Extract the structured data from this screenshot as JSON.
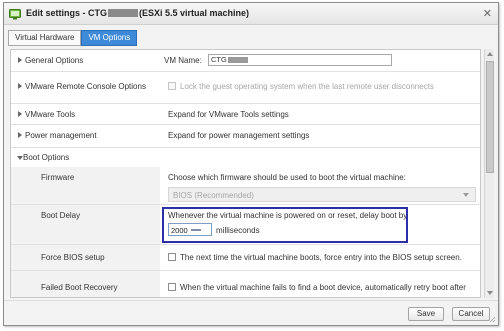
{
  "window": {
    "title_prefix": "Edit settings - CTG",
    "title_suffix": "(ESXi 5.5 virtual machine)",
    "close_symbol": "✕"
  },
  "tabs": [
    {
      "label": "Virtual Hardware",
      "active": false
    },
    {
      "label": "VM Options",
      "active": true
    }
  ],
  "rows": {
    "general": {
      "label": "General Options",
      "vm_name_label": "VM Name:",
      "vm_name_value": "CTG"
    },
    "vmrc": {
      "label": "VMware Remote Console Options",
      "text": "Lock the guest operating system when the last remote user disconnects"
    },
    "tools": {
      "label": "VMware Tools",
      "text": "Expand for VMware Tools settings"
    },
    "power": {
      "label": "Power management",
      "text": "Expand for power management settings"
    },
    "boot": {
      "label": "Boot Options"
    },
    "firmware": {
      "label": "Firmware",
      "text": "Choose which firmware should be used to boot the virtual machine:",
      "select_value": "BIOS (Recommended)"
    },
    "boot_delay": {
      "label": "Boot Delay",
      "text": "Whenever the virtual machine is powered on or reset, delay boot by",
      "value": "2000",
      "unit": "milliseconds"
    },
    "force_bios": {
      "label": "Force BIOS setup",
      "text": "The next time the virtual machine boots, force entry into the BIOS setup screen."
    },
    "failed_boot": {
      "label": "Failed Boot Recovery",
      "text": "When the virtual machine fails to find a boot device, automatically retry boot after"
    }
  },
  "buttons": {
    "save": "Save",
    "cancel": "Cancel"
  },
  "colors": {
    "accent": "#3e8ad8",
    "highlight_border": "#2c2fa5"
  }
}
